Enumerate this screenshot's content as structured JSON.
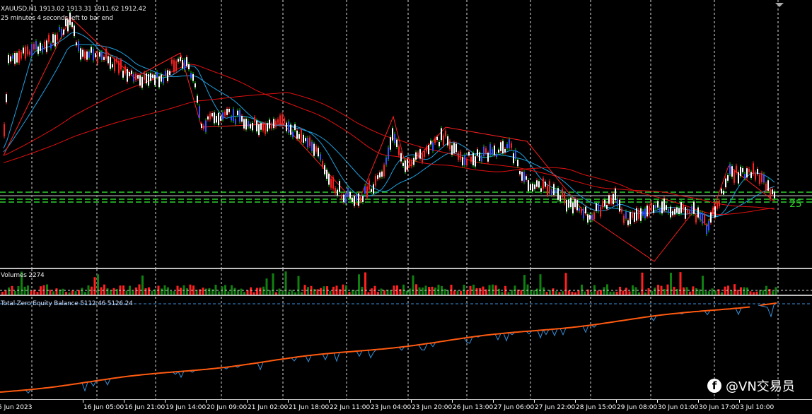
{
  "header": {
    "symbol_line": "XAUUSD,H1  1913.02 1913.31 1911.62 1912.42",
    "timer": "25 minutes 4 seconds left to bar end"
  },
  "volume_pane": {
    "label": "Volumes 2274"
  },
  "equity_pane": {
    "label": "Total Zero Equity Balance 5112.46 5126.24"
  },
  "price_tag": "25",
  "time_axis": [
    "5 Jun 2023",
    "16 Jun 05:00",
    "16 Jun 21:00",
    "19 Jun 14:00",
    "20 Jun 09:00",
    "21 Jun 02:00",
    "21 Jun 18:00",
    "22 Jun 11:00",
    "23 Jun 04:00",
    "23 Jun 20:00",
    "26 Jun 13:00",
    "27 Jun 06:00",
    "27 Jun 22:00",
    "28 Jun 15:00",
    "29 Jun 08:00",
    "30 Jun 01:00",
    "30 Jun 17:00",
    "3 Jul 10:00"
  ],
  "watermark": {
    "icon": "facebook-icon",
    "text": "@VN交易员"
  },
  "colors": {
    "bull": "#00c000",
    "bear": "#ff2020",
    "ma_fast": "#1ea0e0",
    "ma_slow": "#e01010",
    "grid": "#ffffff",
    "equity": "#ff5a10",
    "balance_line": "#3a8fd8"
  }
}
